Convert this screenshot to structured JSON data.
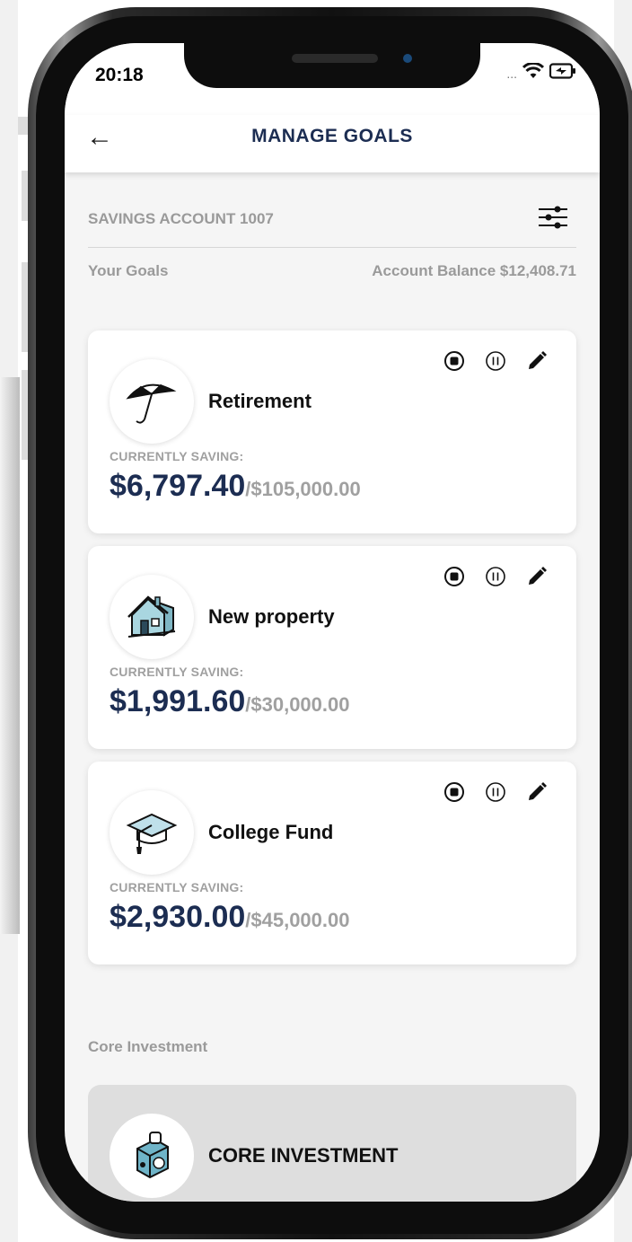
{
  "status_bar": {
    "time": "20:18",
    "dots": "..."
  },
  "header": {
    "back_icon": "arrow-left-icon",
    "title": "MANAGE GOALS"
  },
  "account": {
    "name": "SAVINGS ACCOUNT 1007",
    "filter_icon": "sliders-icon",
    "your_goals_label": "Your Goals",
    "balance_text": "Account Balance $12,408.71"
  },
  "goals": [
    {
      "name": "Retirement",
      "icon": "umbrella-icon",
      "saving_label": "CURRENTLY SAVING:",
      "current": "$6,797.40",
      "target": "/$105,000.00"
    },
    {
      "name": "New property",
      "icon": "house-icon",
      "saving_label": "CURRENTLY SAVING:",
      "current": "$1,991.60",
      "target": "/$30,000.00"
    },
    {
      "name": "College Fund",
      "icon": "graduation-cap-icon",
      "saving_label": "CURRENTLY SAVING:",
      "current": "$2,930.00",
      "target": "/$45,000.00"
    }
  ],
  "card_actions": [
    "stop-icon",
    "pause-icon",
    "edit-pencil-icon"
  ],
  "core_section": {
    "label": "Core Investment",
    "card_title": "CORE INVESTMENT",
    "icon": "money-jar-icon"
  },
  "colors": {
    "navy": "#1c2d52",
    "muted_gray": "#9a9a9a",
    "card_bg": "#ffffff",
    "core_bg": "#dedede"
  }
}
